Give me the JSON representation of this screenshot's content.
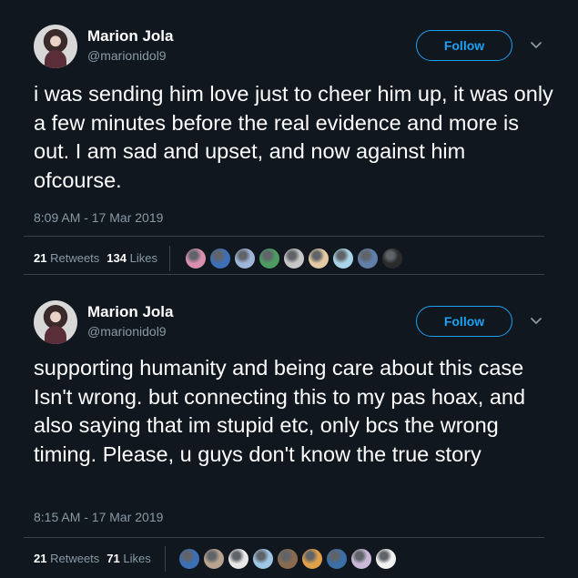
{
  "tweets": [
    {
      "author": {
        "name": "Marion Jola",
        "handle": "@marionidol9"
      },
      "follow_label": "Follow",
      "text": "i was sending him love just to cheer him up, it was only a few minutes before the real evidence and more is out. I am sad and upset, and now against him ofcourse.",
      "timestamp": "8:09 AM - 17 Mar 2019",
      "retweets_count": "21",
      "retweets_label": "Retweets",
      "likes_count": "134",
      "likes_label": "Likes",
      "liker_colors": [
        "#d88fb0",
        "#3d6fb6",
        "#9fb5d9",
        "#4d9a63",
        "#c7c7c7",
        "#e4c9a4",
        "#a9d4e8",
        "#5f7fa8",
        "#2b2b2b"
      ]
    },
    {
      "author": {
        "name": "Marion Jola",
        "handle": "@marionidol9"
      },
      "follow_label": "Follow",
      "text": "supporting humanity and being care about this case Isn't wrong. but connecting this to my pas hoax, and also saying that im stupid etc, only bcs the wrong timing. Please, u guys don't know the true story",
      "timestamp": "8:15 AM - 17 Mar 2019",
      "retweets_count": "21",
      "retweets_label": "Retweets",
      "likes_count": "71",
      "likes_label": "Likes",
      "liker_colors": [
        "#3d6fb6",
        "#b8a38f",
        "#e8e8e8",
        "#9ec7e6",
        "#8b6b4e",
        "#e0a04a",
        "#3b6fa8",
        "#c9b8d8",
        "#f2f2f2"
      ]
    }
  ]
}
